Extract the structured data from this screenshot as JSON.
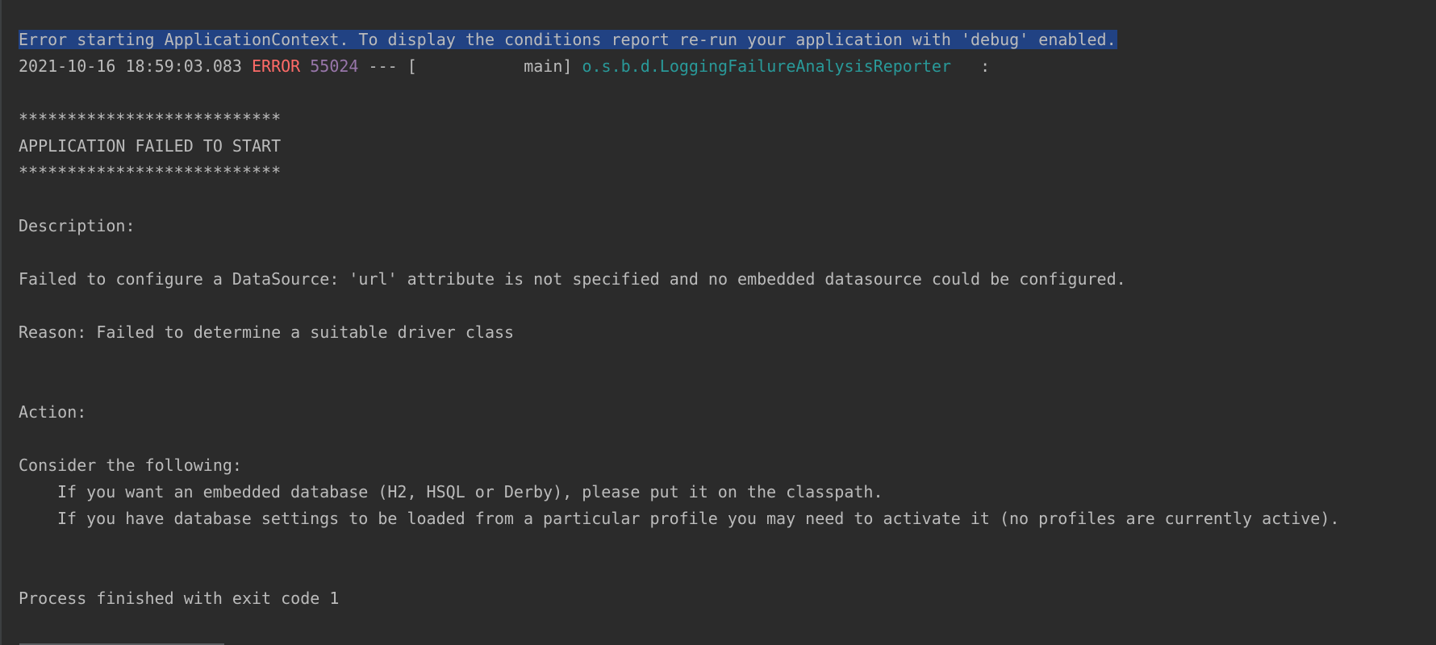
{
  "console": {
    "selected_line": "Error starting ApplicationContext. To display the conditions report re-run your application with 'debug' enabled.",
    "log_line": {
      "timestamp": "2021-10-16 18:59:03.083",
      "level": "ERROR",
      "pid": "55024",
      "separator": "---",
      "thread": "[           main]",
      "logger": "o.s.b.d.LoggingFailureAnalysisReporter",
      "colon": "   :"
    },
    "stars_top": "***************************",
    "banner": "APPLICATION FAILED TO START",
    "stars_bottom": "***************************",
    "description_header": "Description:",
    "description_text": "Failed to configure a DataSource: 'url' attribute is not specified and no embedded datasource could be configured.",
    "reason_text": "Reason: Failed to determine a suitable driver class",
    "action_header": "Action:",
    "consider_text": "Consider the following:",
    "suggestion_1": "If you want an embedded database (H2, HSQL or Derby), please put it on the classpath.",
    "suggestion_2": "If you have database settings to be loaded from a particular profile you may need to activate it (no profiles are currently active).",
    "exit_text": "Process finished with exit code 1"
  },
  "colors": {
    "background": "#2b2b2b",
    "text": "#bbbbbb",
    "selection": "#214283",
    "error_level": "#ff6b68",
    "pid": "#9876aa",
    "logger": "#299999"
  }
}
